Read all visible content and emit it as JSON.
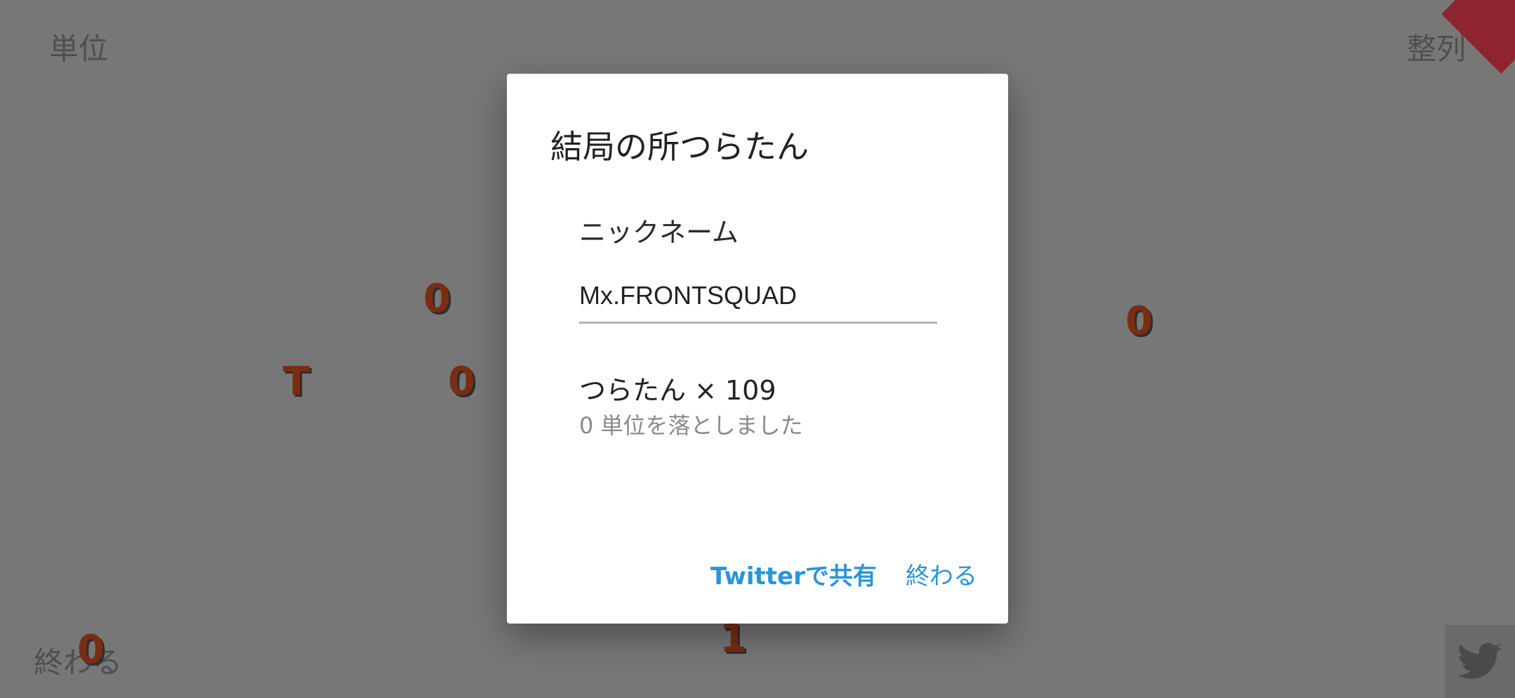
{
  "screen": {
    "top_left_label": "単位",
    "top_right_label": "整列",
    "bottom_left_label": "終わる"
  },
  "falling_units": [
    "0",
    "0",
    "T",
    "0",
    "0",
    "1"
  ],
  "twitter_icon": "twitter-bird-icon",
  "dialog": {
    "title": "結局の所つらたん",
    "nickname_label": "ニックネーム",
    "nickname_value": "Mx.FRONTSQUAD",
    "score_line": "つらたん × 109",
    "score_sub": "0 単位を落としました",
    "share_button": "Twitterで共有",
    "finish_button": "終わる"
  },
  "colors": {
    "overlay": "#777777",
    "accent": "#2a95d8",
    "falling_unit": "#7a2d12",
    "corner_ribbon": "#8d2430"
  }
}
